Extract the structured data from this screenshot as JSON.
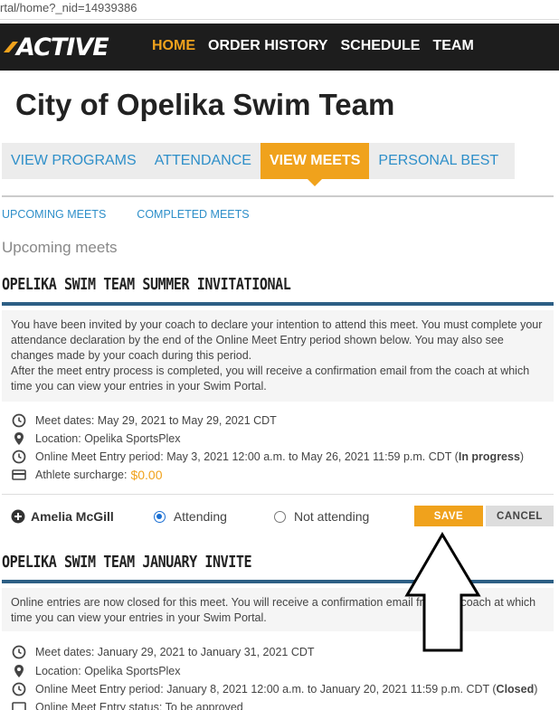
{
  "browser": {
    "url": "rtal/home?_nid=14939386"
  },
  "header": {
    "logo": "ACTIVE",
    "nav": [
      {
        "label": "HOME",
        "active": true
      },
      {
        "label": "ORDER HISTORY",
        "active": false
      },
      {
        "label": "SCHEDULE",
        "active": false
      },
      {
        "label": "TEAM",
        "active": false
      }
    ]
  },
  "page": {
    "title": "City of Opelika Swim Team"
  },
  "tabs": [
    {
      "label": "VIEW PROGRAMS"
    },
    {
      "label": "ATTENDANCE"
    },
    {
      "label": "VIEW MEETS",
      "active": true
    },
    {
      "label": "PERSONAL BEST"
    }
  ],
  "subtabs": [
    "UPCOMING MEETS",
    "COMPLETED MEETS"
  ],
  "section_label": "Upcoming meets",
  "meets": [
    {
      "title": "OPELIKA SWIM TEAM SUMMER INVITATIONAL",
      "info_lines": [
        "You have been invited by your coach to declare your intention to attend this meet. You must complete your attendance declaration by the end of the Online Meet Entry period shown below. You may also see changes made by your coach during this period.",
        "After the meet entry process is completed, you will receive a confirmation email from the coach at which time you can view your entries in your Swim Portal."
      ],
      "meet_dates": "Meet dates: May 29, 2021 to May 29, 2021 CDT",
      "location": "Location: Opelika SportsPlex",
      "entry_period": "Online Meet Entry period: May 3, 2021 12:00 a.m. to May 26, 2021 11:59 p.m. CDT (",
      "entry_status": "In progress",
      "entry_close": ")",
      "surcharge_label": "Athlete surcharge:",
      "surcharge_value": "$0.00",
      "athlete": {
        "name": "Amelia McGill",
        "attending_label": "Attending",
        "not_attending_label": "Not attending",
        "selected": "Attending",
        "save_label": "SAVE",
        "cancel_label": "CANCEL"
      }
    },
    {
      "title": "OPELIKA SWIM TEAM JANUARY INVITE",
      "info_lines": [
        "Online entries are now closed for this meet. You will receive a confirmation email from the coach at which time you can view your entries in your Swim Portal."
      ],
      "meet_dates": "Meet dates: January 29, 2021 to January 31, 2021 CDT",
      "location": "Location: Opelika SportsPlex",
      "entry_period": "Online Meet Entry period: January 8, 2021 12:00 a.m. to January 20, 2021 11:59 p.m. CDT (",
      "entry_status": "Closed",
      "entry_close": ")",
      "entry_status_line": "Online Meet Entry status: To be approved"
    }
  ],
  "colors": {
    "accent": "#f0a21c",
    "link": "#2e8fc9",
    "rule": "#2d5f85",
    "nav_bg": "#1d1d1d"
  }
}
